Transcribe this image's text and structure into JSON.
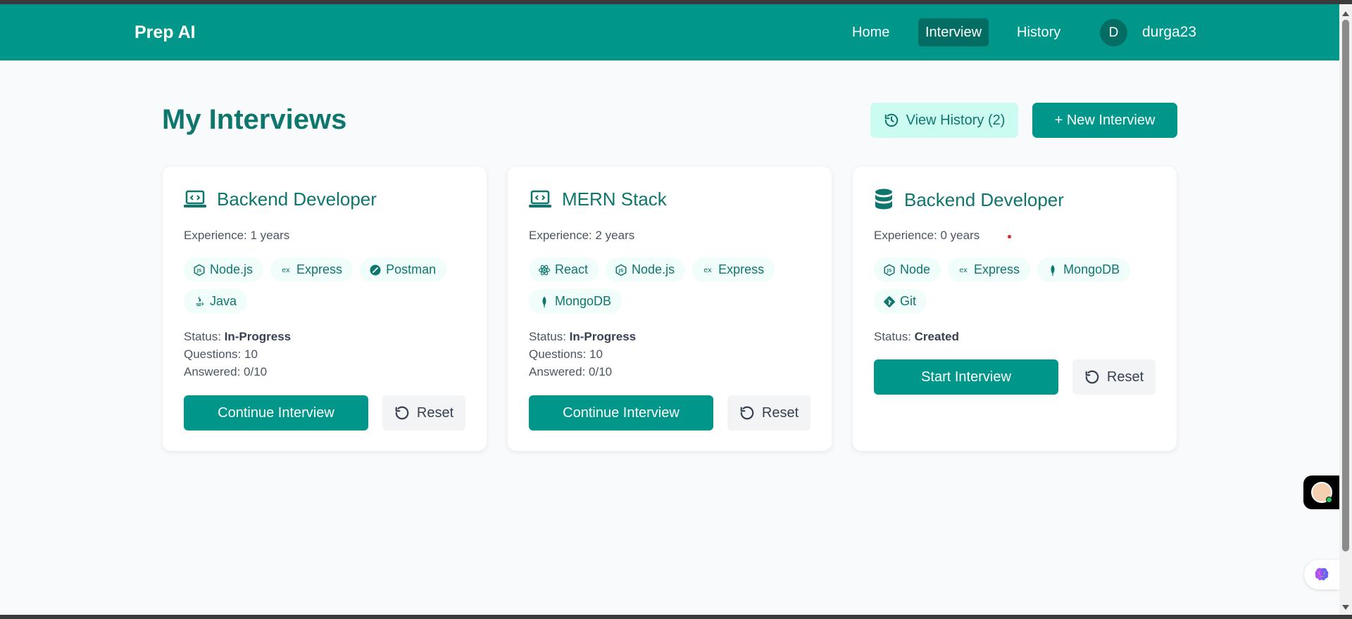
{
  "app": {
    "brand": "Prep AI",
    "accent": "#00968a",
    "accent_dark": "#0f766e"
  },
  "nav": {
    "items": [
      {
        "label": "Home",
        "active": false
      },
      {
        "label": "Interview",
        "active": true
      },
      {
        "label": "History",
        "active": false
      }
    ],
    "user": {
      "initial": "D",
      "name": "durga23"
    }
  },
  "page": {
    "title": "My Interviews",
    "view_history_label": "View History (2)",
    "new_interview_label": "+ New Interview"
  },
  "cards": [
    {
      "icon": "laptop-code-icon",
      "title": "Backend Developer",
      "experience": "Experience: 1 years",
      "tags": [
        {
          "label": "Node.js",
          "icon": "nodejs-icon"
        },
        {
          "label": "Express",
          "icon": "express-icon"
        },
        {
          "label": "Postman",
          "icon": "postman-icon"
        },
        {
          "label": "Java",
          "icon": "java-icon"
        }
      ],
      "status_label": "Status:",
      "status": "In-Progress",
      "questions": "Questions: 10",
      "answered": "Answered: 0/10",
      "primary_action": "Continue Interview",
      "reset_label": "Reset"
    },
    {
      "icon": "laptop-code-icon",
      "title": "MERN Stack",
      "experience": "Experience: 2 years",
      "tags": [
        {
          "label": "React",
          "icon": "react-icon"
        },
        {
          "label": "Node.js",
          "icon": "nodejs-icon"
        },
        {
          "label": "Express",
          "icon": "express-icon"
        },
        {
          "label": "MongoDB",
          "icon": "mongodb-icon"
        }
      ],
      "status_label": "Status:",
      "status": "In-Progress",
      "questions": "Questions: 10",
      "answered": "Answered: 0/10",
      "primary_action": "Continue Interview",
      "reset_label": "Reset"
    },
    {
      "icon": "database-icon",
      "title": "Backend Developer",
      "experience": "Experience: 0 years",
      "tags": [
        {
          "label": "Node",
          "icon": "nodejs-icon"
        },
        {
          "label": "Express",
          "icon": "express-icon"
        },
        {
          "label": "MongoDB",
          "icon": "mongodb-icon"
        },
        {
          "label": "Git",
          "icon": "git-icon"
        }
      ],
      "status_label": "Status:",
      "status": "Created",
      "primary_action": "Start Interview",
      "reset_label": "Reset"
    }
  ]
}
